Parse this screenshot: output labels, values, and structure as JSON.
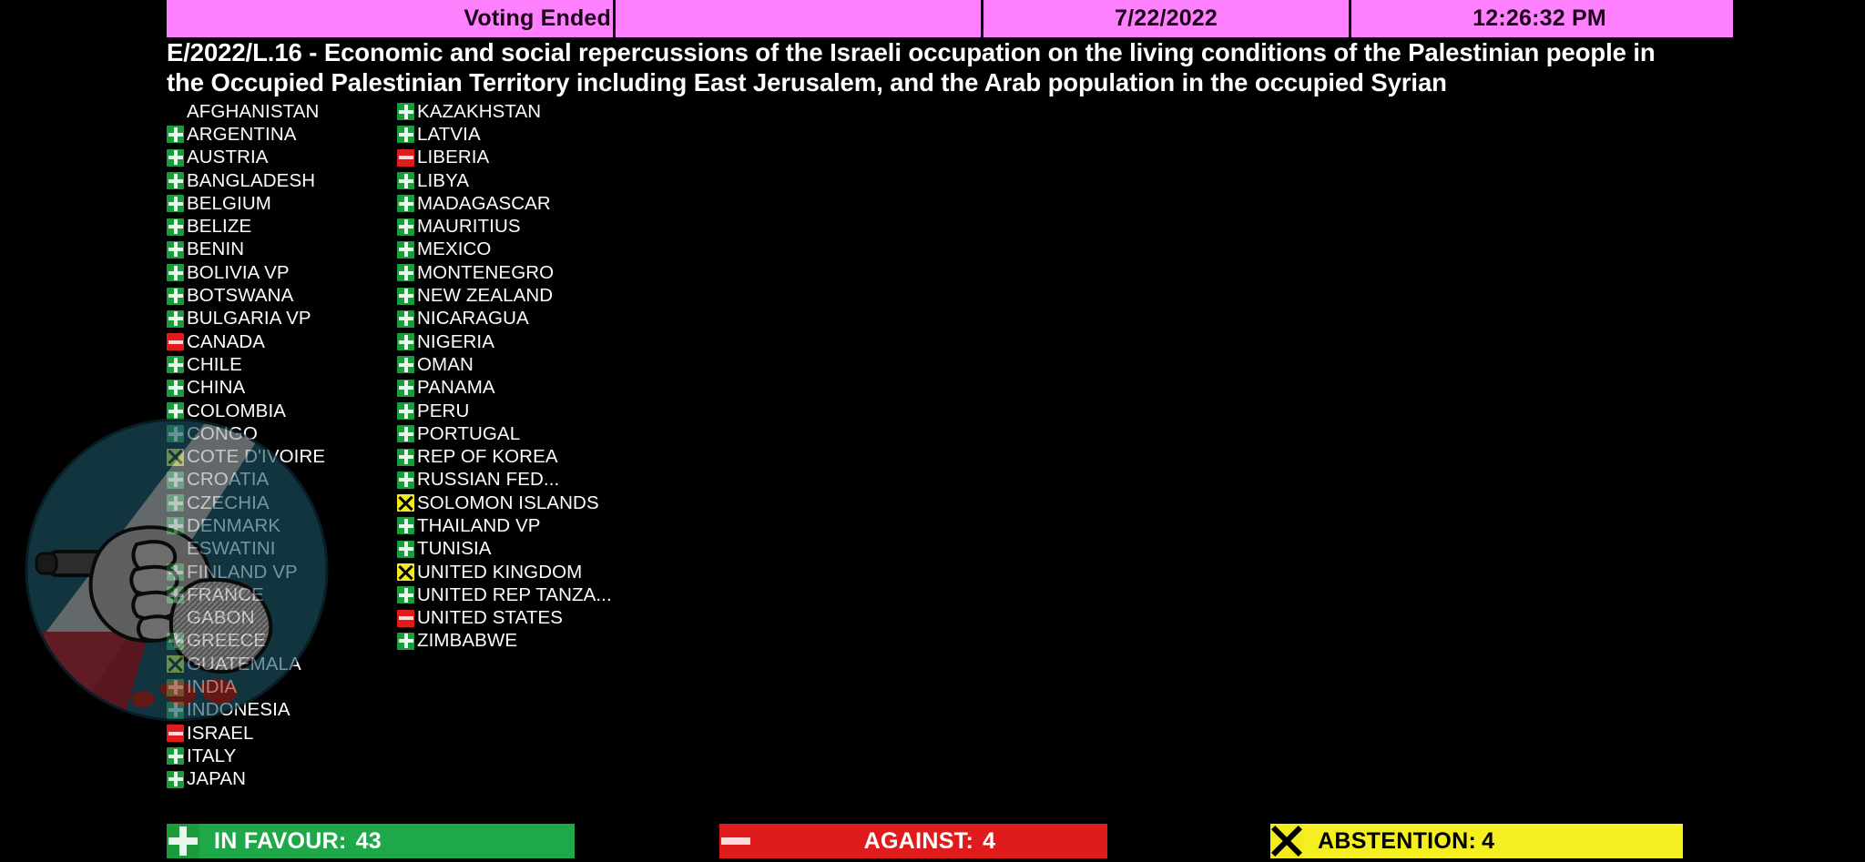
{
  "header": {
    "status": "Voting Ended",
    "blank": "",
    "date": "7/22/2022",
    "time": "12:26:32 PM"
  },
  "title": "E/2022/L.16 - Economic and social repercussions of the Israeli occupation on the living conditions of the Palestinian people in the Occupied Palestinian Territory including East Jerusalem, and the Arab population in the occupied Syrian",
  "legend": {
    "yes": "in-favour",
    "no": "against",
    "abs": "abstention",
    "none": "absent"
  },
  "colors": {
    "header_bg": "#FF80FF",
    "favour": "#1EA84A",
    "against": "#E01B1B",
    "abstention": "#F5EF22",
    "background": "#000000",
    "text": "#FFFFFF"
  },
  "columns": [
    {
      "id": "column-1",
      "rows": [
        {
          "name": "AFGHANISTAN",
          "vote": "none"
        },
        {
          "name": "ARGENTINA",
          "vote": "yes"
        },
        {
          "name": "AUSTRIA",
          "vote": "yes"
        },
        {
          "name": "BANGLADESH",
          "vote": "yes"
        },
        {
          "name": "BELGIUM",
          "vote": "yes"
        },
        {
          "name": "BELIZE",
          "vote": "yes"
        },
        {
          "name": "BENIN",
          "vote": "yes"
        },
        {
          "name": "BOLIVIA VP",
          "vote": "yes"
        },
        {
          "name": "BOTSWANA",
          "vote": "yes"
        },
        {
          "name": "BULGARIA VP",
          "vote": "yes"
        },
        {
          "name": "CANADA",
          "vote": "no"
        },
        {
          "name": "CHILE",
          "vote": "yes"
        },
        {
          "name": "CHINA",
          "vote": "yes"
        },
        {
          "name": "COLOMBIA",
          "vote": "yes"
        },
        {
          "name": "CONGO",
          "vote": "yes"
        },
        {
          "name": "COTE D'IVOIRE",
          "vote": "abs"
        },
        {
          "name": "CROATIA",
          "vote": "yes"
        },
        {
          "name": "CZECHIA",
          "vote": "yes"
        },
        {
          "name": "DENMARK",
          "vote": "yes"
        },
        {
          "name": "ESWATINI",
          "vote": "none"
        },
        {
          "name": "FINLAND VP",
          "vote": "yes"
        },
        {
          "name": "FRANCE",
          "vote": "yes"
        },
        {
          "name": "GABON",
          "vote": "none"
        },
        {
          "name": "GREECE",
          "vote": "yes"
        },
        {
          "name": "GUATEMALA",
          "vote": "abs"
        },
        {
          "name": "INDIA",
          "vote": "yes"
        },
        {
          "name": "INDONESIA",
          "vote": "yes"
        },
        {
          "name": "ISRAEL",
          "vote": "no"
        },
        {
          "name": "ITALY",
          "vote": "yes"
        },
        {
          "name": "JAPAN",
          "vote": "yes"
        }
      ]
    },
    {
      "id": "column-2",
      "rows": [
        {
          "name": "KAZAKHSTAN",
          "vote": "yes"
        },
        {
          "name": "LATVIA",
          "vote": "yes"
        },
        {
          "name": "LIBERIA",
          "vote": "no"
        },
        {
          "name": "LIBYA",
          "vote": "yes"
        },
        {
          "name": "MADAGASCAR",
          "vote": "yes"
        },
        {
          "name": "MAURITIUS",
          "vote": "yes"
        },
        {
          "name": "MEXICO",
          "vote": "yes"
        },
        {
          "name": "MONTENEGRO",
          "vote": "yes"
        },
        {
          "name": "NEW ZEALAND",
          "vote": "yes"
        },
        {
          "name": "NICARAGUA",
          "vote": "yes"
        },
        {
          "name": "NIGERIA",
          "vote": "yes"
        },
        {
          "name": "OMAN",
          "vote": "yes"
        },
        {
          "name": "PANAMA",
          "vote": "yes"
        },
        {
          "name": "PERU",
          "vote": "yes"
        },
        {
          "name": "PORTUGAL",
          "vote": "yes"
        },
        {
          "name": "REP OF KOREA",
          "vote": "yes"
        },
        {
          "name": "RUSSIAN FED...",
          "vote": "yes"
        },
        {
          "name": "SOLOMON ISLANDS",
          "vote": "abs"
        },
        {
          "name": "THAILAND VP",
          "vote": "yes"
        },
        {
          "name": "TUNISIA",
          "vote": "yes"
        },
        {
          "name": "UNITED KINGDOM",
          "vote": "abs"
        },
        {
          "name": "UNITED REP TANZA...",
          "vote": "yes"
        },
        {
          "name": "UNITED STATES",
          "vote": "no"
        },
        {
          "name": "ZIMBABWE",
          "vote": "yes"
        }
      ]
    }
  ],
  "footer": {
    "favour_label": "IN FAVOUR:",
    "favour_count": "43",
    "against_label": "AGAINST:",
    "against_count": "4",
    "abstention_label": "ABSTENTION:",
    "abstention_count": "4"
  }
}
